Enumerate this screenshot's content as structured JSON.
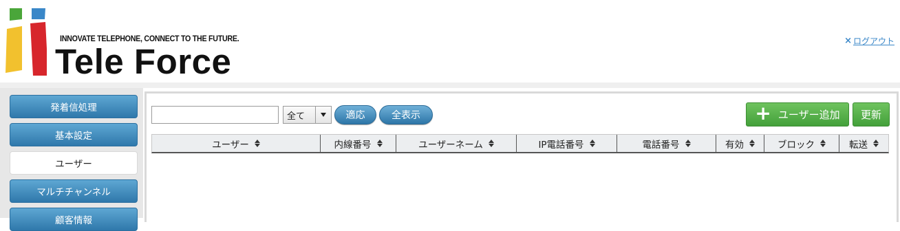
{
  "header": {
    "tagline": "INNOVATE TELEPHONE, CONNECT TO THE FUTURE.",
    "brand": "Tele Force",
    "logout_label": "ログアウト",
    "logout_icon": "×"
  },
  "colors": {
    "accent_blue": "#2f78ab",
    "green": "#43a03a",
    "logo_red": "#d7262c",
    "logo_green": "#4aa63a",
    "logo_blue": "#3a87c8",
    "logo_yellow": "#f2c12e"
  },
  "sidebar": {
    "items": [
      {
        "label": "発着信処理",
        "active": false
      },
      {
        "label": "基本設定",
        "active": false
      },
      {
        "label": "ユーザー",
        "active": true
      },
      {
        "label": "マルチチャンネル",
        "active": false
      },
      {
        "label": "顧客情報",
        "active": false
      }
    ]
  },
  "toolbar": {
    "search_value": "",
    "filter_selected": "全て",
    "apply_label": "適応",
    "show_all_label": "全表示",
    "add_user_label": "ユーザー追加",
    "refresh_label": "更新"
  },
  "table": {
    "columns": [
      "ユーザー",
      "内線番号",
      "ユーザーネーム",
      "IP電話番号",
      "電話番号",
      "有効",
      "ブロック",
      "転送"
    ],
    "rows": []
  }
}
